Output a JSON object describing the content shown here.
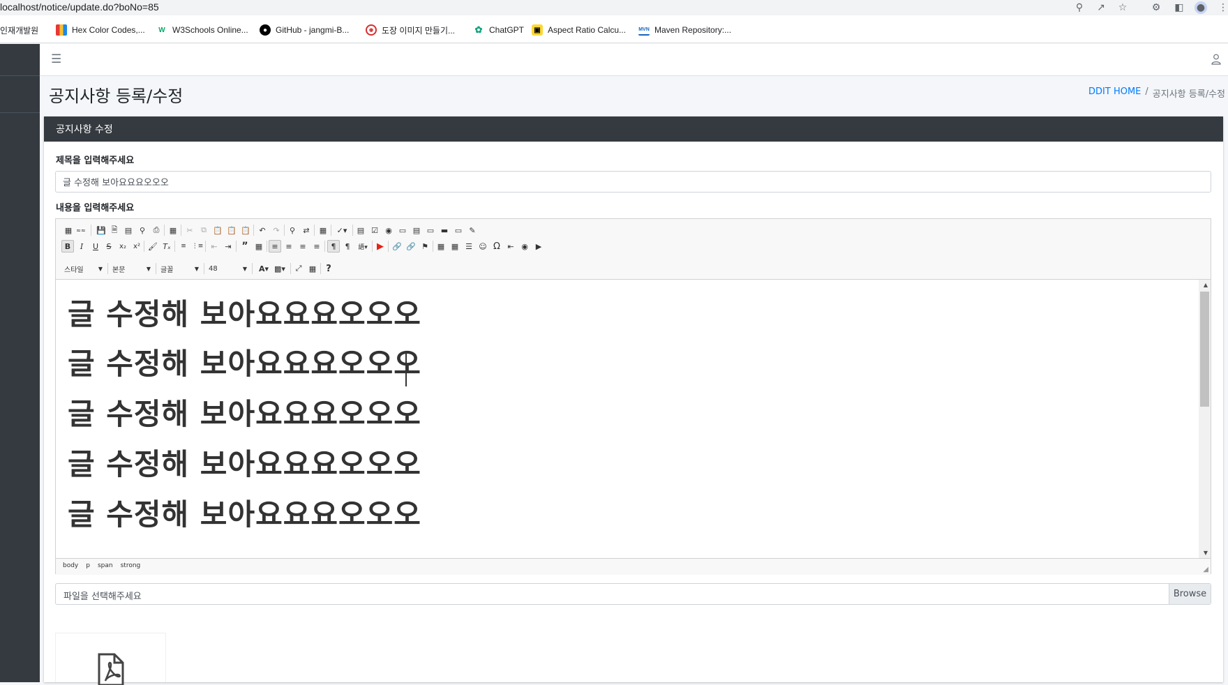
{
  "browser": {
    "url": "localhost/notice/update.do?boNo=85",
    "bookmarks": [
      {
        "label": "인재개발원",
        "icon": "bookmark-icon"
      },
      {
        "label": "Hex Color Codes,...",
        "icon": "color-bars-icon"
      },
      {
        "label": "W3Schools Online...",
        "icon": "w3schools-icon"
      },
      {
        "label": "GitHub - jangmi-B...",
        "icon": "github-icon"
      },
      {
        "label": "도장 이미지 만들기...",
        "icon": "stamp-icon"
      },
      {
        "label": "ChatGPT",
        "icon": "chatgpt-icon"
      },
      {
        "label": "Aspect Ratio Calcu...",
        "icon": "aspect-ratio-icon"
      },
      {
        "label": "Maven Repository:...",
        "icon": "maven-icon"
      }
    ]
  },
  "page": {
    "title": "공지사항 등록/수정",
    "breadcrumb": {
      "home": "DDIT HOME",
      "separator": "/",
      "current": "공지사항 등록/수정"
    }
  },
  "card": {
    "header": "공지사항 수정",
    "title_label": "제목을 입력해주세요",
    "title_value": "글 수정해 보아요요요오오오",
    "content_label": "내용을 입력해주세요"
  },
  "editor": {
    "combos": {
      "style": "스타일",
      "format": "본문",
      "font": "글꼴",
      "size": "48"
    },
    "lines": [
      "글 수정해 보아요요요오오오",
      "글 수정해 보아요요요오오오",
      "글 수정해 보아요요요오오오",
      "글 수정해 보아요요요오오오",
      "글 수정해 보아요요요오오오"
    ],
    "path": [
      "body",
      "p",
      "span",
      "strong"
    ]
  },
  "file": {
    "placeholder": "파일을 선택해주세요",
    "browse_label": "Browse"
  },
  "colors": {
    "sidebar": "#343a40",
    "card_header": "#343a40",
    "link": "#007bff",
    "page_bg": "#f4f6f9"
  }
}
